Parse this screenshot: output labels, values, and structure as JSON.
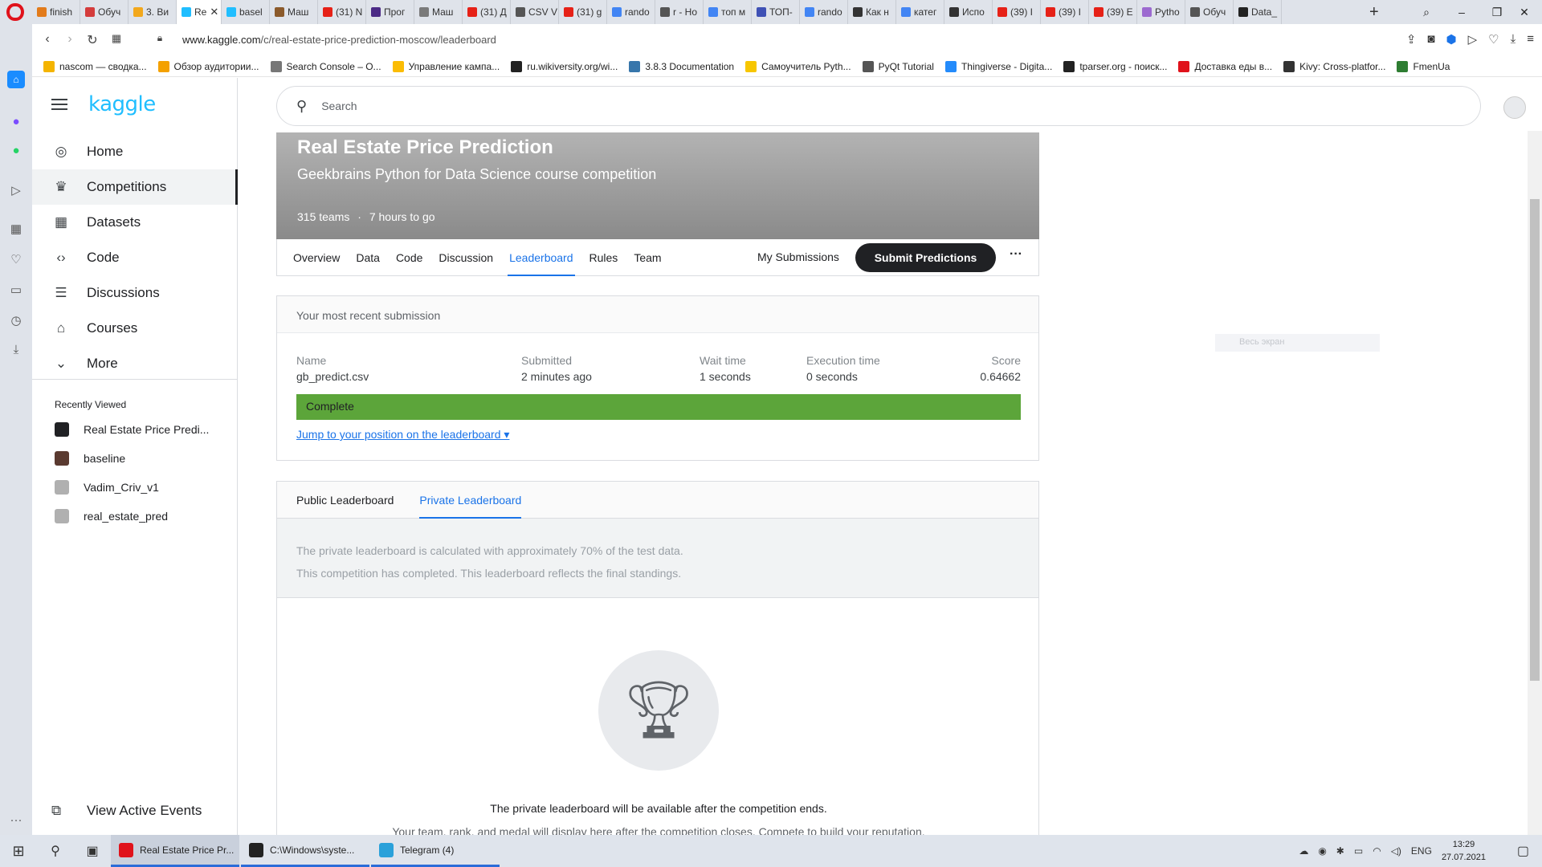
{
  "browser": {
    "tabs": [
      {
        "label": "finish",
        "color": "#e27b1b"
      },
      {
        "label": "Обуч",
        "color": "#d43c3c"
      },
      {
        "label": "3. Ви",
        "color": "#f2a81d"
      },
      {
        "label": "Re",
        "color": "#20beff",
        "active": true
      },
      {
        "label": "basel",
        "color": "#20beff"
      },
      {
        "label": "Маш",
        "color": "#8b5a2b"
      },
      {
        "label": "(31) N",
        "color": "#e62117"
      },
      {
        "label": "Прог",
        "color": "#4b2a86"
      },
      {
        "label": "Маш",
        "color": "#7a7a7a"
      },
      {
        "label": "(31) Д",
        "color": "#e62117"
      },
      {
        "label": "CSV V",
        "color": "#555555"
      },
      {
        "label": "(31) g",
        "color": "#e62117"
      },
      {
        "label": "rando",
        "color": "#4285f4"
      },
      {
        "label": "r - Ho",
        "color": "#555555"
      },
      {
        "label": "топ м",
        "color": "#4285f4"
      },
      {
        "label": "ТОП-",
        "color": "#3f51b5"
      },
      {
        "label": "rando",
        "color": "#4285f4"
      },
      {
        "label": "Как н",
        "color": "#333333"
      },
      {
        "label": "катег",
        "color": "#4285f4"
      },
      {
        "label": "Испо",
        "color": "#333333"
      },
      {
        "label": "(39) I",
        "color": "#e62117"
      },
      {
        "label": "(39) I",
        "color": "#e62117"
      },
      {
        "label": "(39) E",
        "color": "#e62117"
      },
      {
        "label": "Pytho",
        "color": "#9c6ad0"
      },
      {
        "label": "Обуч",
        "color": "#555555"
      },
      {
        "label": "Data_",
        "color": "#222222"
      }
    ],
    "new_tab": "+",
    "url_host": "www.kaggle.com",
    "url_path": "/c/real-estate-price-prediction-moscow/leaderboard",
    "bookmarks": [
      {
        "label": "nascom — сводка...",
        "color": "#f4b400"
      },
      {
        "label": "Обзор аудитории...",
        "color": "#f4a100"
      },
      {
        "label": "Search Console – O...",
        "color": "#777777"
      },
      {
        "label": "Управление кампа...",
        "color": "#fbbc04"
      },
      {
        "label": "ru.wikiversity.org/wi...",
        "color": "#222222"
      },
      {
        "label": "3.8.3 Documentation",
        "color": "#3776ab"
      },
      {
        "label": "Самоучитель Pyth...",
        "color": "#f7c600"
      },
      {
        "label": "PyQt Tutorial",
        "color": "#555555"
      },
      {
        "label": "Thingiverse - Digita...",
        "color": "#248bfb"
      },
      {
        "label": "tparser.org - поиск...",
        "color": "#222222"
      },
      {
        "label": "Доставка еды в...",
        "color": "#e0121b"
      },
      {
        "label": "Kivy: Cross-platfor...",
        "color": "#333333"
      },
      {
        "label": "FmenUa",
        "color": "#2e7d32"
      }
    ]
  },
  "sidebar": {
    "logo": "kaggle",
    "nav": [
      {
        "label": "Home",
        "icon": "◎",
        "name": "home"
      },
      {
        "label": "Competitions",
        "icon": "♛",
        "name": "competitions",
        "active": true
      },
      {
        "label": "Datasets",
        "icon": "▦",
        "name": "datasets"
      },
      {
        "label": "Code",
        "icon": "‹›",
        "name": "code"
      },
      {
        "label": "Discussions",
        "icon": "☰",
        "name": "discussions"
      },
      {
        "label": "Courses",
        "icon": "⌂",
        "name": "courses"
      },
      {
        "label": "More",
        "icon": "⌄",
        "name": "more"
      }
    ],
    "recently_viewed_title": "Recently Viewed",
    "recently_viewed": [
      {
        "label": "Real Estate Price Predi...",
        "color": "#202124"
      },
      {
        "label": "baseline",
        "color": "#5a3a30"
      },
      {
        "label": "Vadim_Criv_v1",
        "color": "#b0b0b0"
      },
      {
        "label": "real_estate_pred",
        "color": "#b0b0b0"
      }
    ],
    "view_active_events": "View Active Events"
  },
  "search": {
    "placeholder": "Search"
  },
  "competition": {
    "title": "Real Estate Price Prediction",
    "subtitle": "Geekbrains Python for Data Science course competition",
    "teams": "315 teams",
    "separator": "·",
    "time_left": "7 hours to go",
    "tabs": [
      "Overview",
      "Data",
      "Code",
      "Discussion",
      "Leaderboard",
      "Rules",
      "Team"
    ],
    "active_tab": "Leaderboard",
    "my_submissions": "My Submissions",
    "submit_button": "Submit Predictions",
    "more": "···"
  },
  "recent_submission": {
    "header": "Your most recent submission",
    "labels": {
      "name": "Name",
      "submitted": "Submitted",
      "wait": "Wait time",
      "exec": "Execution time",
      "score": "Score"
    },
    "values": {
      "name": "gb_predict.csv",
      "submitted": "2 minutes ago",
      "wait": "1 seconds",
      "exec": "0 seconds",
      "score": "0.64662"
    },
    "status": "Complete",
    "status_color": "#5ca53a",
    "jump_link": "Jump to your position on the leaderboard ▾"
  },
  "leaderboard": {
    "tabs": [
      "Public Leaderboard",
      "Private Leaderboard"
    ],
    "active_tab": "Private Leaderboard",
    "notice_line1": "The private leaderboard is calculated with approximately 70% of the test data.",
    "notice_line2": "This competition has completed. This leaderboard reflects the final standings.",
    "empty_message": "The private leaderboard will be available after the competition ends.",
    "empty_sub": "Your team, rank, and medal will display here after the competition closes. Compete to build your reputation."
  },
  "overlay_ghost": "Весь экран",
  "taskbar": {
    "apps": [
      {
        "label": "Real Estate Price Pr...",
        "color": "#e0121b",
        "active": true
      },
      {
        "label": "C:\\Windows\\syste...",
        "color": "#222222"
      },
      {
        "label": "Telegram (4)",
        "color": "#2aa1da"
      }
    ],
    "lang": "ENG",
    "time": "13:29",
    "date": "27.07.2021"
  },
  "colors": {
    "accent": "#1a73e8",
    "kaggle": "#20beff"
  }
}
